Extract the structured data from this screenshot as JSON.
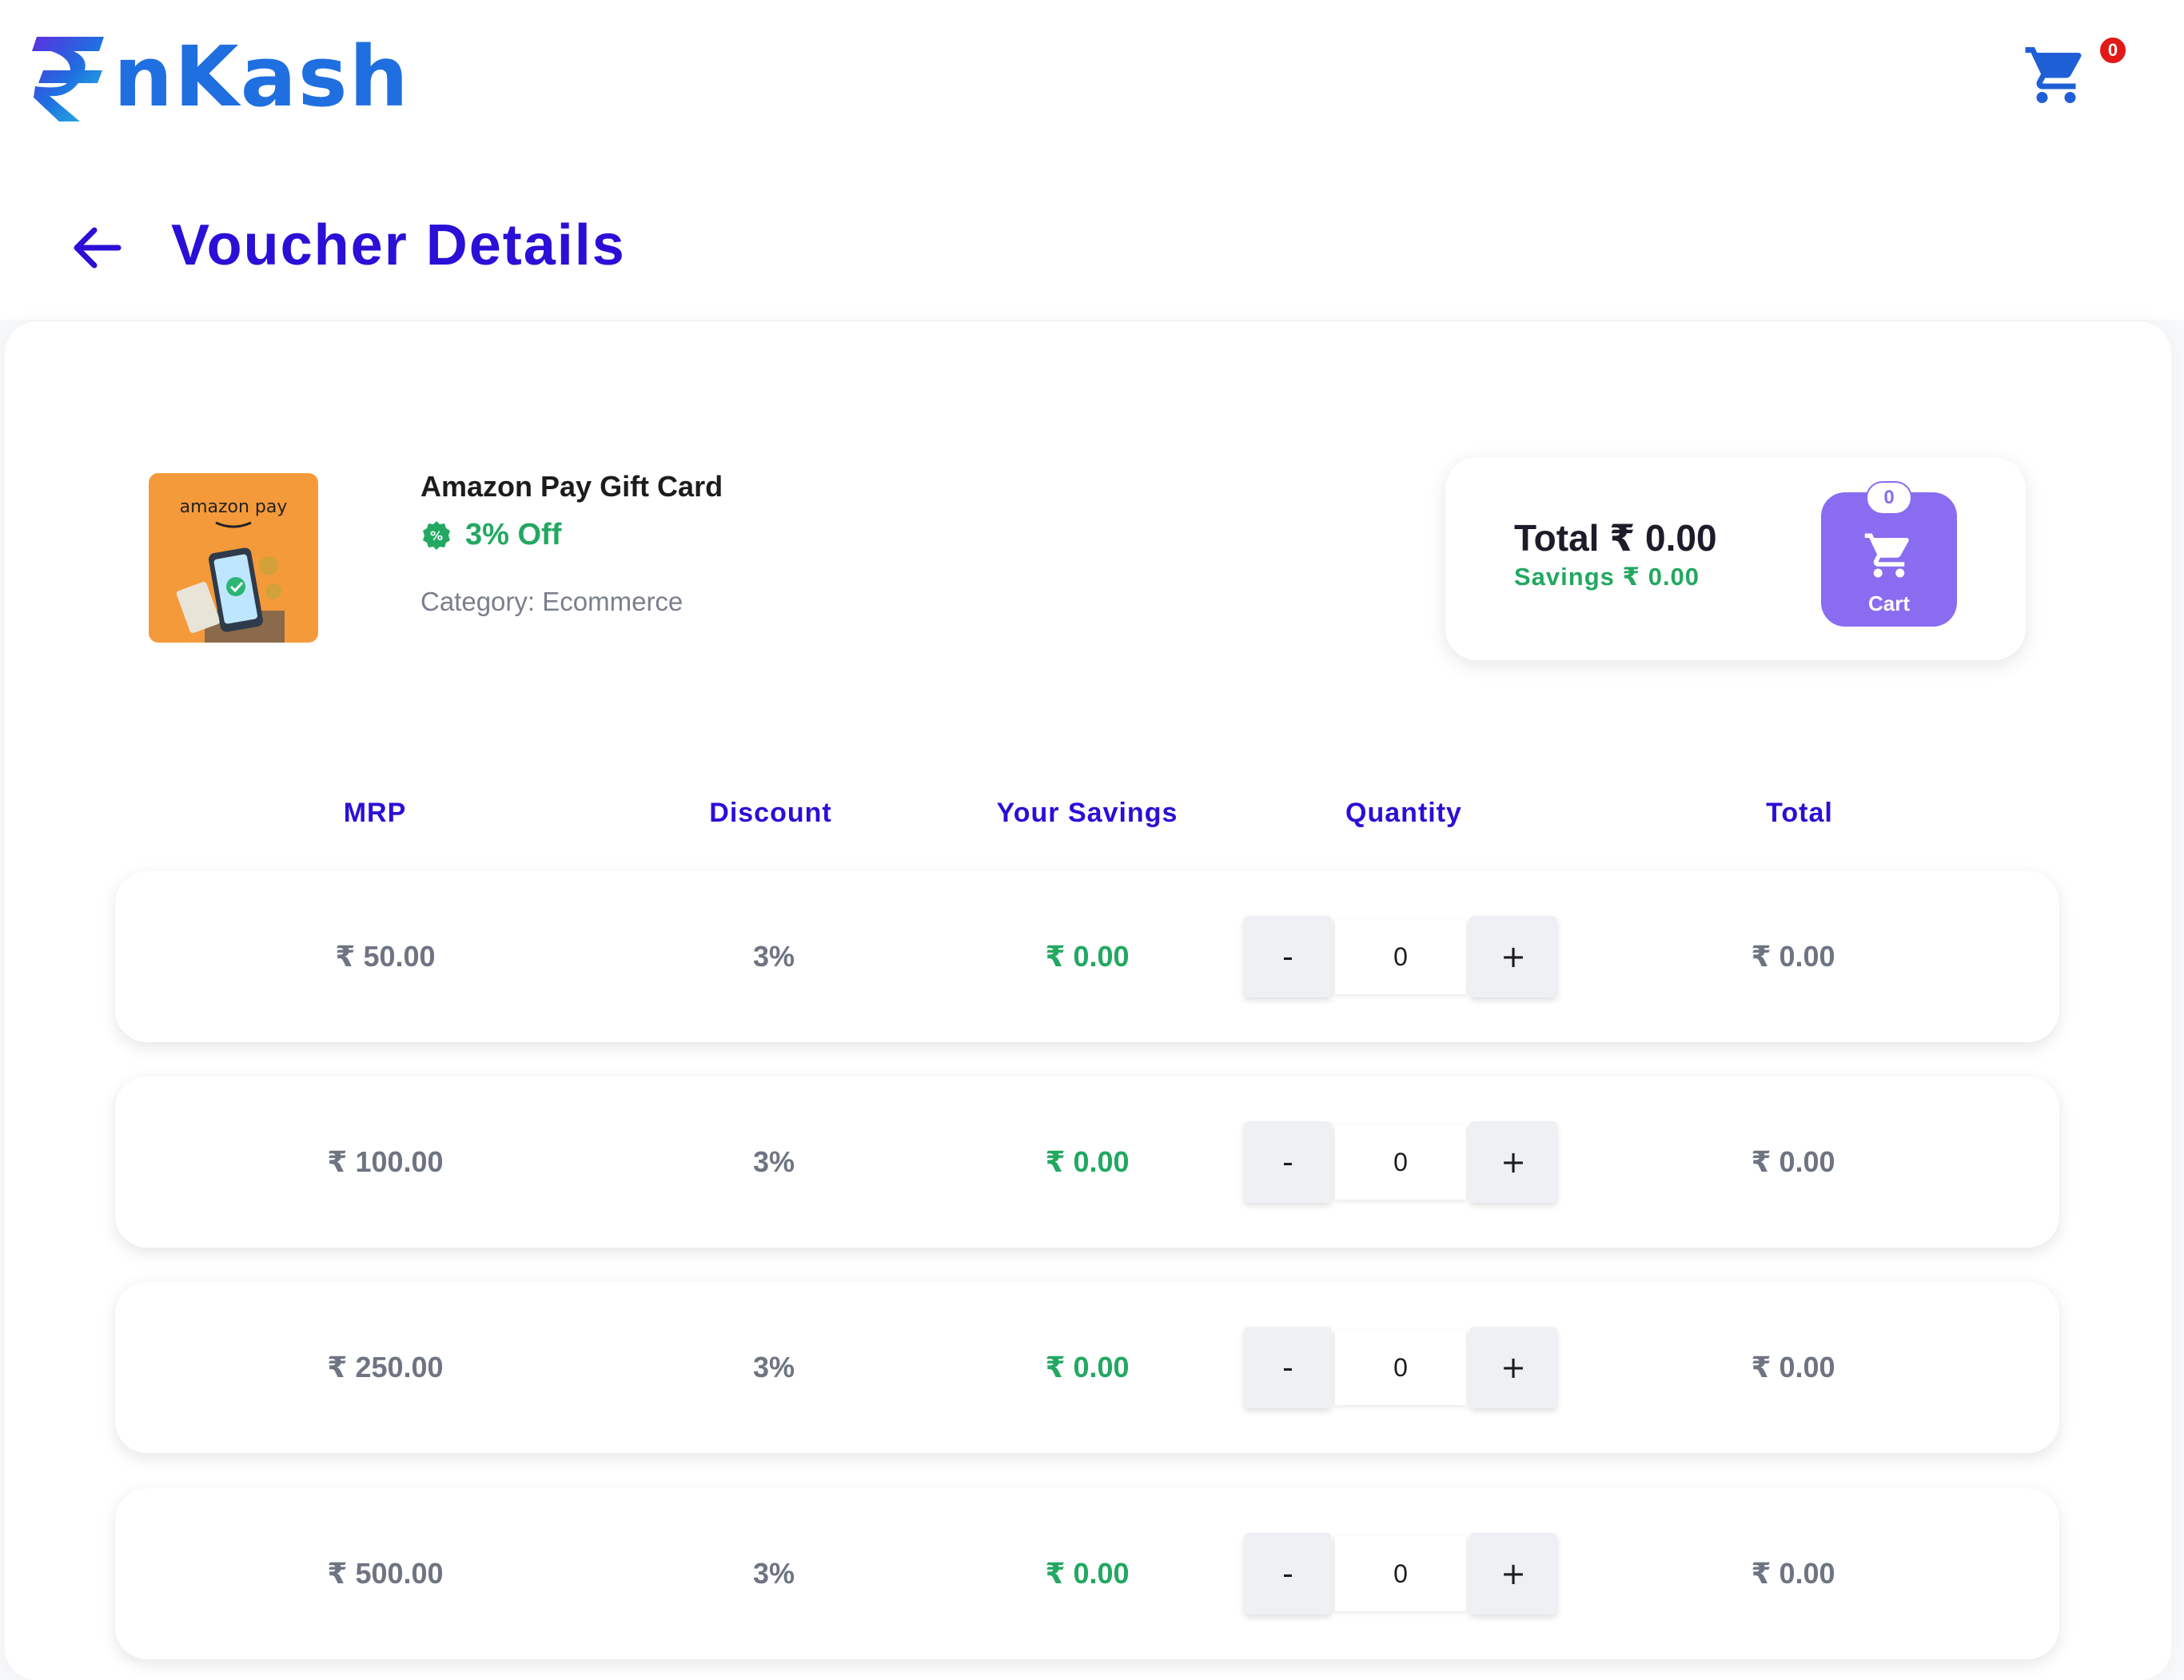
{
  "app": {
    "brand": "nKash",
    "cart_badge": "0"
  },
  "page": {
    "title": "Voucher Details"
  },
  "product": {
    "name": "Amazon Pay Gift Card",
    "offer": "3% Off",
    "category_label": "Category:",
    "category_value": "Ecommerce",
    "image_brand": "amazon pay"
  },
  "summary": {
    "total_label": "Total",
    "total_value": "₹ 0.00",
    "savings_label": "Savings",
    "savings_value": "₹ 0.00",
    "cart_label": "Cart",
    "cart_count": "0"
  },
  "table": {
    "headers": [
      "MRP",
      "Discount",
      "Your Savings",
      "Quantity",
      "Total"
    ],
    "rows": [
      {
        "mrp": "₹ 50.00",
        "discount": "3%",
        "savings": "₹ 0.00",
        "quantity": "0",
        "total": "₹ 0.00"
      },
      {
        "mrp": "₹ 100.00",
        "discount": "3%",
        "savings": "₹ 0.00",
        "quantity": "0",
        "total": "₹ 0.00"
      },
      {
        "mrp": "₹ 250.00",
        "discount": "3%",
        "savings": "₹ 0.00",
        "quantity": "0",
        "total": "₹ 0.00"
      },
      {
        "mrp": "₹ 500.00",
        "discount": "3%",
        "savings": "₹ 0.00",
        "quantity": "0",
        "total": "₹ 0.00"
      }
    ],
    "decrement_label": "-",
    "increment_label": "+"
  },
  "colors": {
    "primary": "#2a0fd6",
    "success": "#22a861",
    "cart_button": "#8a6cf0",
    "badge": "#e11919"
  },
  "icons": {
    "back": "arrow-left-icon",
    "cart": "shopping-cart-icon",
    "offer": "discount-badge-icon"
  }
}
